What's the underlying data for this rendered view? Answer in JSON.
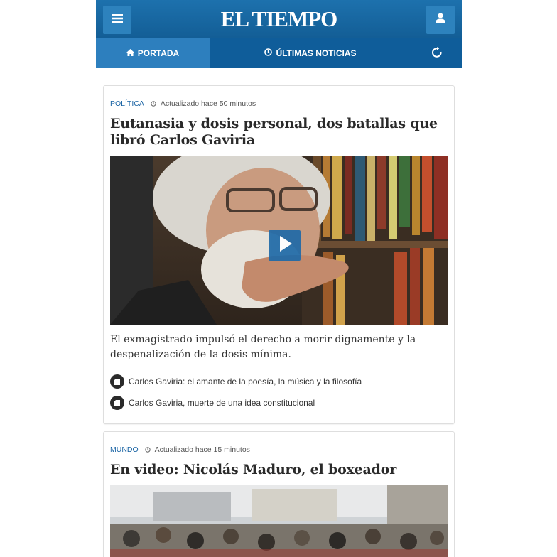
{
  "header": {
    "logo": "EL TIEMPO",
    "icons": {
      "menu": "menu-icon",
      "user": "user-icon"
    }
  },
  "nav": {
    "portada": "PORTADA",
    "ultimas": "ÚLTIMAS NOTICIAS",
    "refresh_icon": "refresh-icon"
  },
  "articles": [
    {
      "section": "POLÍTICA",
      "updated": "Actualizado hace 50 minutos",
      "headline": "Eutanasia y dosis personal, dos batallas que libró Carlos Gaviria",
      "summary": "El exmagistrado impulsó el derecho a morir dignamente y la despenalización de la dosis mínima.",
      "related": [
        "Carlos Gaviria: el amante de la poesía, la música y la filosofía",
        "Carlos Gaviria, muerte de una idea constitucional"
      ]
    },
    {
      "section": "MUNDO",
      "updated": "Actualizado hace 15 minutos",
      "headline": "En video: Nicolás Maduro, el boxeador"
    }
  ],
  "colors": {
    "header_blue": "#135e96",
    "accent_blue": "#1a64a4",
    "active_tab": "#2d7fbe"
  }
}
